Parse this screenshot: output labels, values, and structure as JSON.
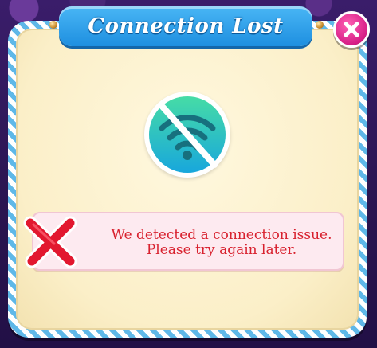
{
  "dialog": {
    "title": "Connection Lost",
    "message": "We detected a connection issue. Please try again later.",
    "close_icon": "close-icon",
    "status_icon": "no-wifi-icon",
    "error_icon": "red-x-icon"
  },
  "colors": {
    "title_bar": "#2a9bea",
    "close_button": "#d61f86",
    "message_text": "#d8212e",
    "panel": "#fbefc8",
    "border_stripe": "#5fb8e8",
    "wifi_gradient_top": "#3fd8a8",
    "wifi_gradient_bottom": "#1aa8d8"
  }
}
